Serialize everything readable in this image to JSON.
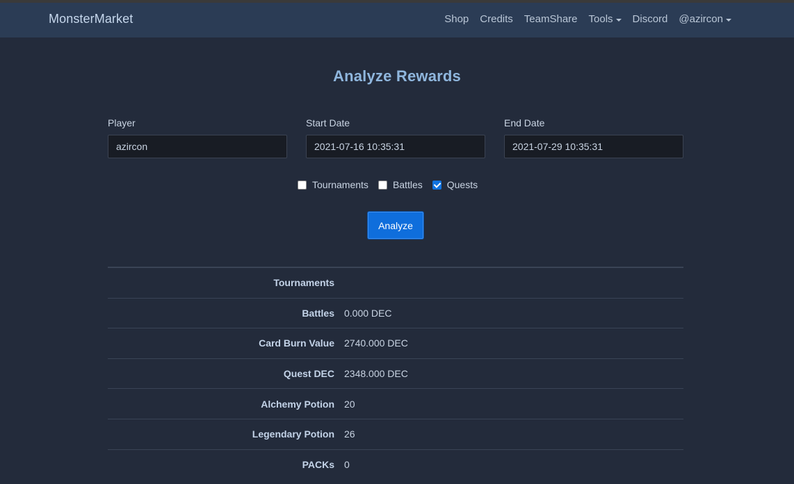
{
  "brand": "MonsterMarket",
  "nav": {
    "items": [
      {
        "label": "Shop",
        "dropdown": false
      },
      {
        "label": "Credits",
        "dropdown": false
      },
      {
        "label": "TeamShare",
        "dropdown": false
      },
      {
        "label": "Tools",
        "dropdown": true
      },
      {
        "label": "Discord",
        "dropdown": false
      },
      {
        "label": "@azircon",
        "dropdown": true
      }
    ]
  },
  "page_title": "Analyze Rewards",
  "form": {
    "player_label": "Player",
    "player_value": "azircon",
    "start_label": "Start Date",
    "start_value": "2021-07-16 10:35:31",
    "end_label": "End Date",
    "end_value": "2021-07-29 10:35:31",
    "checkboxes": [
      {
        "label": "Tournaments",
        "checked": false
      },
      {
        "label": "Battles",
        "checked": false
      },
      {
        "label": "Quests",
        "checked": true
      }
    ],
    "analyze_label": "Analyze"
  },
  "results": [
    {
      "label": "Tournaments",
      "value": ""
    },
    {
      "label": "Battles",
      "value": "0.000 DEC"
    },
    {
      "label": "Card Burn Value",
      "value": "2740.000 DEC"
    },
    {
      "label": "Quest DEC",
      "value": "2348.000 DEC"
    },
    {
      "label": "Alchemy Potion",
      "value": "20"
    },
    {
      "label": "Legendary Potion",
      "value": "26"
    },
    {
      "label": "PACKs",
      "value": "0"
    }
  ]
}
